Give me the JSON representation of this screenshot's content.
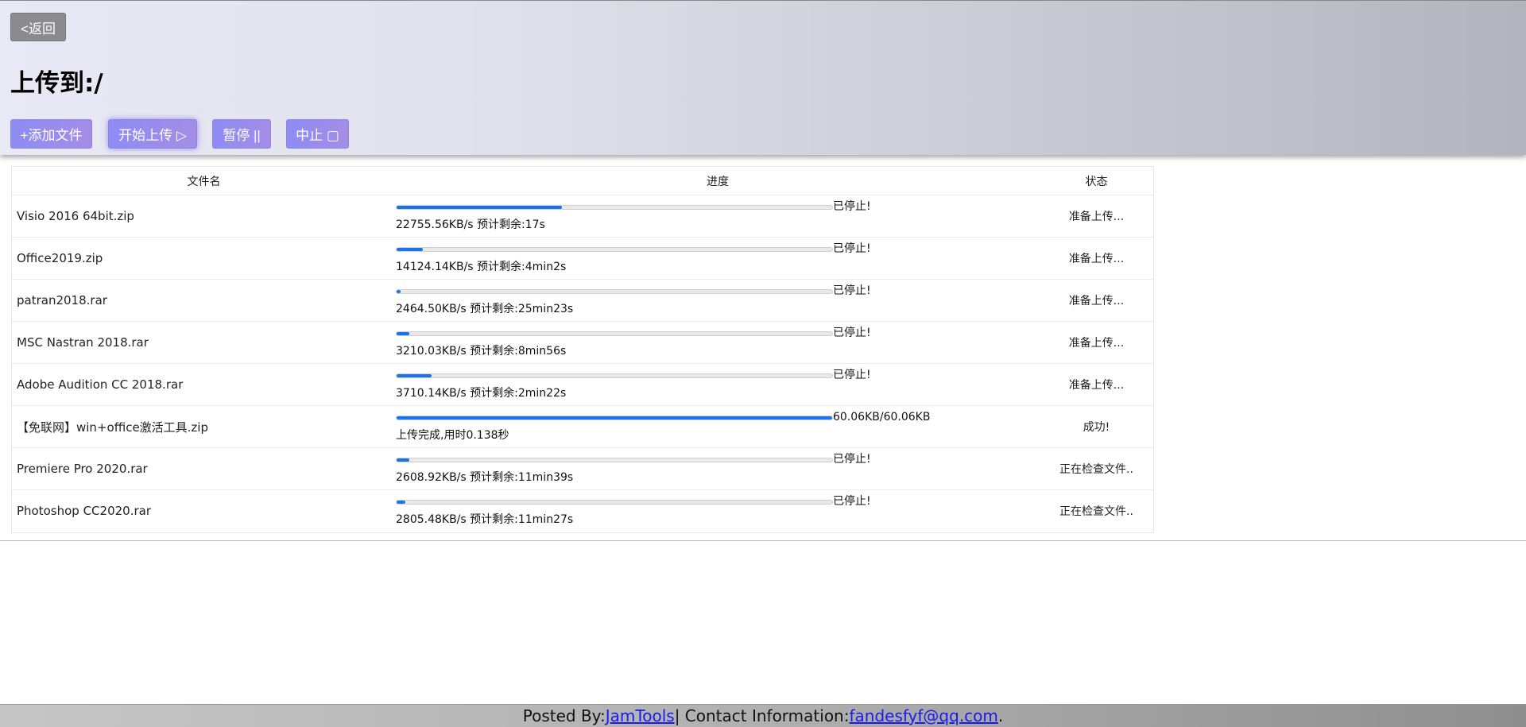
{
  "header": {
    "back_label": "<返回",
    "title": "上传到:/",
    "buttons": {
      "add": "+添加文件",
      "start": "开始上传 ▷",
      "pause": "暂停 ||",
      "stop": "中止 ▢"
    }
  },
  "table": {
    "columns": [
      "文件名",
      "进度",
      "状态"
    ],
    "rows": [
      {
        "name": "Visio 2016 64bit.zip",
        "progress": 0.38,
        "bar_label": "已停止!",
        "speed": "22755.56KB/s 预计剩余:17s",
        "status": "准备上传..."
      },
      {
        "name": "Office2019.zip",
        "progress": 0.06,
        "bar_label": "已停止!",
        "speed": "14124.14KB/s 预计剩余:4min2s",
        "status": "准备上传..."
      },
      {
        "name": "patran2018.rar",
        "progress": 0.01,
        "bar_label": "已停止!",
        "speed": "2464.50KB/s 预计剩余:25min23s",
        "status": "准备上传..."
      },
      {
        "name": "MSC Nastran 2018.rar",
        "progress": 0.03,
        "bar_label": "已停止!",
        "speed": "3210.03KB/s 预计剩余:8min56s",
        "status": "准备上传..."
      },
      {
        "name": "Adobe Audition CC 2018.rar",
        "progress": 0.08,
        "bar_label": "已停止!",
        "speed": "3710.14KB/s 预计剩余:2min22s",
        "status": "准备上传..."
      },
      {
        "name": "【免联网】win+office激活工具.zip",
        "progress": 1.0,
        "bar_label": "60.06KB/60.06KB",
        "speed": "上传完成,用时0.138秒",
        "status": "成功!"
      },
      {
        "name": "Premiere Pro 2020.rar",
        "progress": 0.03,
        "bar_label": "已停止!",
        "speed": "2608.92KB/s 预计剩余:11min39s",
        "status": "正在检查文件.."
      },
      {
        "name": "Photoshop CC2020.rar",
        "progress": 0.02,
        "bar_label": "已停止!",
        "speed": "2805.48KB/s 预计剩余:11min27s",
        "status": "正在检查文件.."
      }
    ]
  },
  "footer": {
    "prefix": "Posted By: ",
    "author": "JamTools",
    "middle": " | Contact Information: ",
    "email": "fandesfyf@qq.com",
    "suffix": "."
  },
  "colors": {
    "progress_fill": "#1a73e8",
    "button_gradient_start": "#8e8cf5",
    "button_gradient_end": "#a58de6"
  }
}
